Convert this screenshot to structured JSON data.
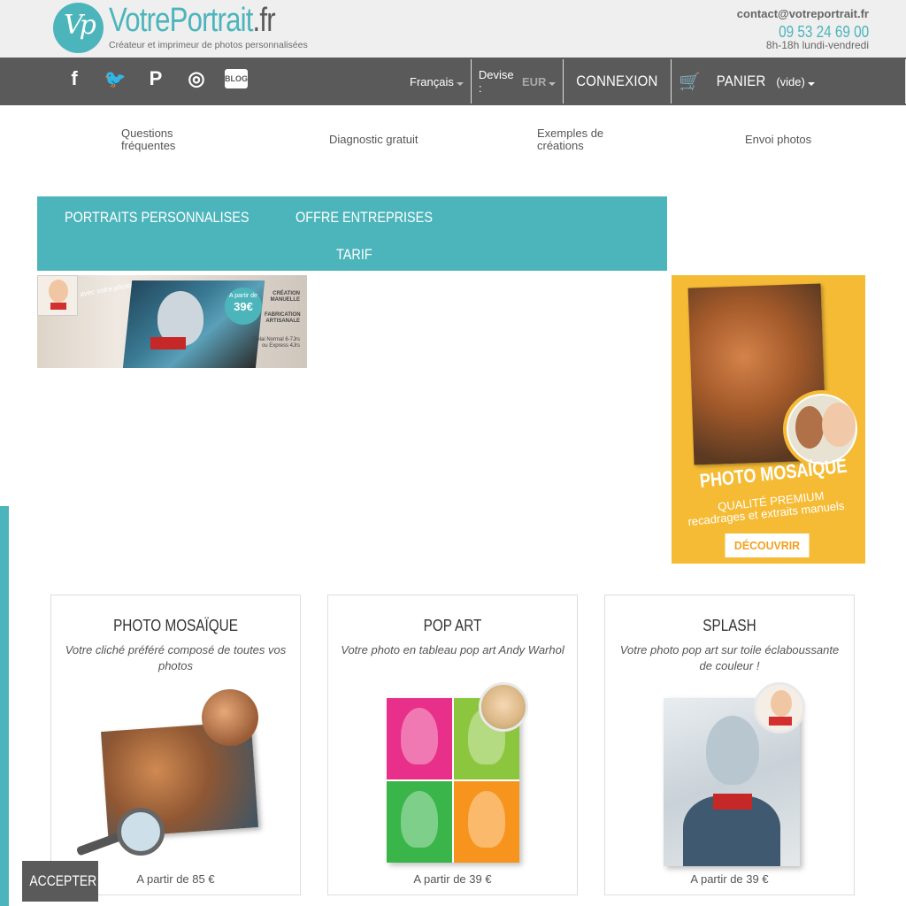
{
  "brand": {
    "logo_letters": "Vp",
    "name_part1": "VotrePortrait",
    "name_part2": ".fr",
    "tagline": "Créateur et imprimeur de photos personnalisées"
  },
  "contact": {
    "email": "contact@votreportrait.fr",
    "phone": "09 53 24 69 00",
    "hours": "8h-18h lundi-vendredi"
  },
  "social": [
    {
      "icon": "facebook-icon",
      "glyph": "f"
    },
    {
      "icon": "twitter-icon",
      "glyph": "🐦"
    },
    {
      "icon": "pinterest-icon",
      "glyph": "P"
    },
    {
      "icon": "instagram-icon",
      "glyph": "◎"
    },
    {
      "icon": "blog-icon",
      "glyph": "BLOG"
    }
  ],
  "nav": {
    "language": "Français",
    "currency_label": "Devise :",
    "currency_value": "EUR",
    "login": "CONNEXION",
    "cart_label": "PANIER",
    "cart_status": "(vide)"
  },
  "sublinks": {
    "faq": "Questions fréquentes",
    "diagnostic": "Diagnostic gratuit",
    "examples": "Exemples de créations",
    "send": "Envoi photos"
  },
  "menu": {
    "portraits": "PORTRAITS PERSONNALISES",
    "business": "OFFRE ENTREPRISES",
    "tarif": "TARIF"
  },
  "banner": {
    "handwriting": "avec votre photo",
    "badge_small": "A partir de",
    "badge_price": "39€",
    "line1": "CRÉATION MANUELLE",
    "line2": "FABRICATION ARTISANALE",
    "line3": "Délai Normal 6-7Jrs ou Express 4Jrs"
  },
  "ad": {
    "title": "PHOTO MOSAÏQUE",
    "line1": "QUALITÉ PREMIUM",
    "line2": "recadrages et extraits manuels",
    "button": "DÉCOUVRIR"
  },
  "products": [
    {
      "title": "PHOTO MOSAÏQUE",
      "desc": "Votre cliché préféré composé de toutes vos photos",
      "price": "A partir de 85 €"
    },
    {
      "title": "POP ART",
      "desc": "Votre photo en tableau pop art Andy Warhol",
      "price": "A partir de 39 €"
    },
    {
      "title": "SPLASH",
      "desc": "Votre photo pop art sur toile éclaboussante de couleur !",
      "price": "A partir de 39 €"
    }
  ],
  "popart_colors": [
    "#e8308a",
    "#8cc63f",
    "#3ab54a",
    "#f7941d"
  ],
  "cookie": {
    "accept": "ACCEPTER"
  },
  "colors": {
    "accent": "#4cb5bb",
    "nav": "#5a5a5a",
    "ad_bg": "#f5bb35"
  }
}
